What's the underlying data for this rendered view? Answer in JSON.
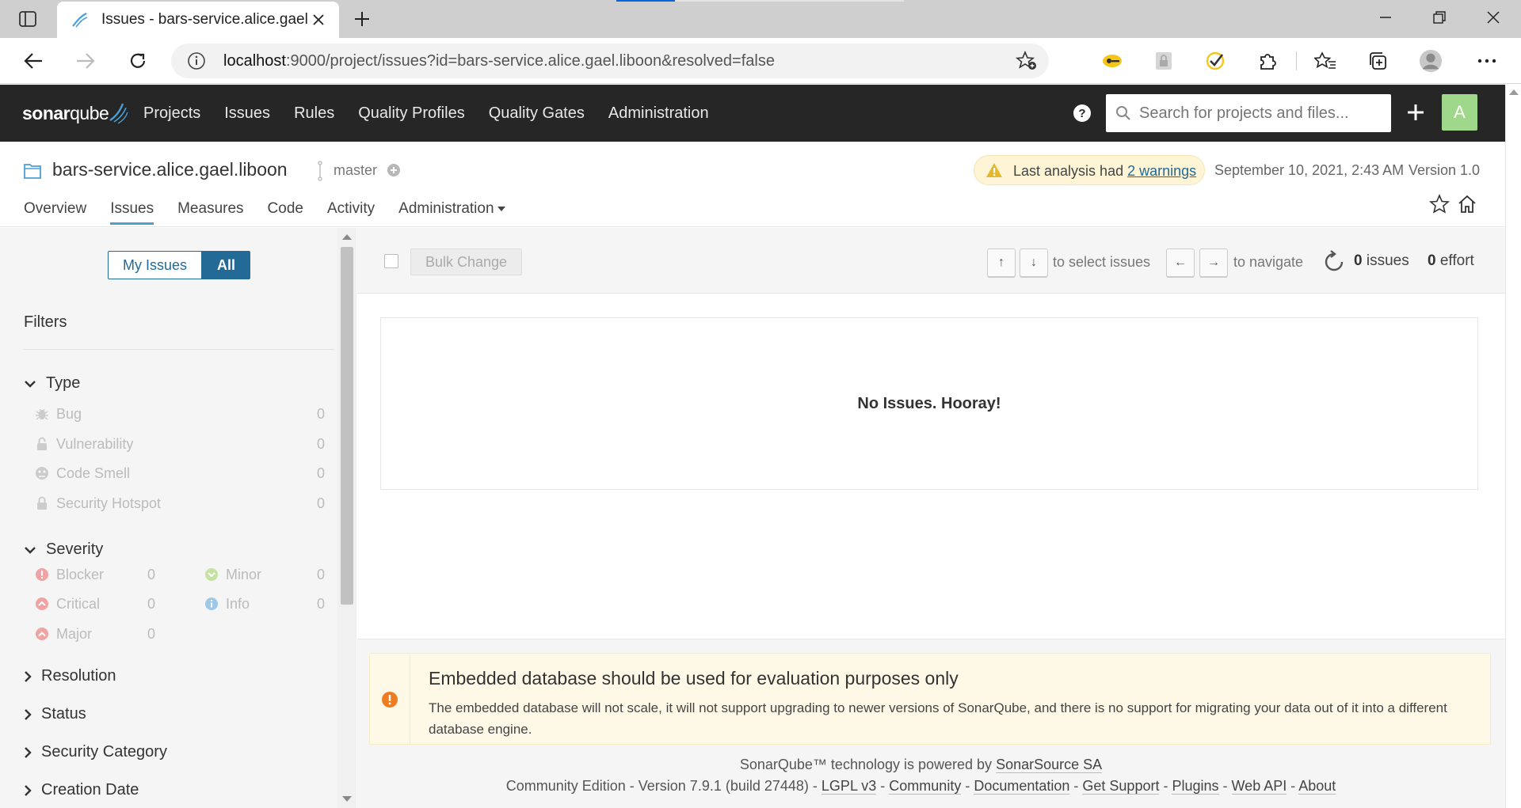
{
  "browser": {
    "tab_title": "Issues - bars-service.alice.gael.liboon",
    "url_host": "localhost",
    "url_rest": ":9000/project/issues?id=bars-service.alice.gael.liboon&resolved=false"
  },
  "header": {
    "logo_left": "sonar",
    "logo_right": "qube",
    "nav": [
      "Projects",
      "Issues",
      "Rules",
      "Quality Profiles",
      "Quality Gates",
      "Administration"
    ],
    "search_placeholder": "Search for projects and files...",
    "avatar_letter": "A"
  },
  "project": {
    "name": "bars-service.alice.gael.liboon",
    "branch": "master",
    "warning_prefix": "Last analysis had ",
    "warning_link": "2 warnings",
    "analysis_date": "September 10, 2021, 2:43 AM",
    "version": "Version 1.0",
    "tabs": [
      "Overview",
      "Issues",
      "Measures",
      "Code",
      "Activity",
      "Administration"
    ]
  },
  "sidebar": {
    "toggle_my": "My Issues",
    "toggle_all": "All",
    "filters_title": "Filters",
    "type": {
      "title": "Type",
      "items": [
        {
          "label": "Bug",
          "count": "0"
        },
        {
          "label": "Vulnerability",
          "count": "0"
        },
        {
          "label": "Code Smell",
          "count": "0"
        },
        {
          "label": "Security Hotspot",
          "count": "0"
        }
      ]
    },
    "severity": {
      "title": "Severity",
      "items": [
        {
          "label": "Blocker",
          "count": "0"
        },
        {
          "label": "Minor",
          "count": "0"
        },
        {
          "label": "Critical",
          "count": "0"
        },
        {
          "label": "Info",
          "count": "0"
        },
        {
          "label": "Major",
          "count": "0"
        }
      ]
    },
    "collapsed_facets": [
      "Resolution",
      "Status",
      "Security Category",
      "Creation Date"
    ]
  },
  "toolbar": {
    "bulk_change": "Bulk Change",
    "key_up": "↑",
    "key_down": "↓",
    "select_label": "to select issues",
    "key_left": "←",
    "key_right": "→",
    "navigate_label": "to navigate",
    "issues_num": "0",
    "issues_label": " issues",
    "effort_num": "0",
    "effort_label": " effort"
  },
  "main": {
    "empty_message": "No Issues. Hooray!"
  },
  "db_warning": {
    "title": "Embedded database should be used for evaluation purposes only",
    "body": "The embedded database will not scale, it will not support upgrading to newer versions of SonarQube, and there is no support for migrating your data out of it into a different database engine."
  },
  "footer": {
    "powered_prefix": "SonarQube™ technology is powered by ",
    "powered_link": "SonarSource SA",
    "edition": "Community Edition",
    "version_text": "Version 7.9.1 (build 27448)",
    "links": [
      "LGPL v3",
      "Community",
      "Documentation",
      "Get Support",
      "Plugins",
      "Web API",
      "About"
    ],
    "separator": " - "
  },
  "colors": {
    "header_bg": "#262626",
    "accent_blue": "#236a97",
    "active_tab": "#4b9fd5",
    "avatar": "#9fd88a",
    "warning_bg": "#fef9e6",
    "warning_icon": "#ed7d20"
  }
}
